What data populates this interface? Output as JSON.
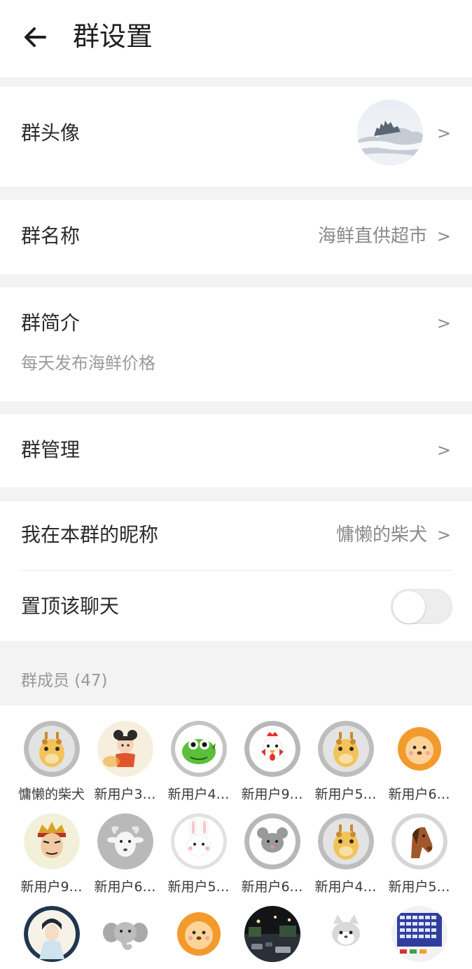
{
  "header": {
    "title": "群设置",
    "back_icon": "arrow-left-icon"
  },
  "rows": {
    "avatar": {
      "label": "群头像",
      "chevron": ">"
    },
    "name": {
      "label": "群名称",
      "value": "海鲜直供超市",
      "chevron": ">"
    },
    "intro": {
      "label": "群简介",
      "value": "每天发布海鲜价格",
      "chevron": ">"
    },
    "manage": {
      "label": "群管理",
      "chevron": ">"
    },
    "nickname": {
      "label": "我在本群的昵称",
      "value": "慵懒的柴犬",
      "chevron": ">"
    },
    "pin": {
      "label": "置顶该聊天",
      "toggle_on": false
    }
  },
  "members": {
    "title": "群成员 (47)",
    "items": [
      {
        "name": "慵懒的柴犬",
        "avatar": "giraffe-icon"
      },
      {
        "name": "新用户3…",
        "avatar": "nezha-icon"
      },
      {
        "name": "新用户4…",
        "avatar": "dragon-icon"
      },
      {
        "name": "新用户9…",
        "avatar": "rooster-icon"
      },
      {
        "name": "新用户5…",
        "avatar": "giraffe-icon"
      },
      {
        "name": "新用户6…",
        "avatar": "lion-icon"
      },
      {
        "name": "新用户9…",
        "avatar": "general-icon"
      },
      {
        "name": "新用户6…",
        "avatar": "goat-icon"
      },
      {
        "name": "新用户5…",
        "avatar": "rabbit-icon"
      },
      {
        "name": "新用户6…",
        "avatar": "mouse-icon"
      },
      {
        "name": "新用户4…",
        "avatar": "giraffe-icon"
      },
      {
        "name": "新用户5…",
        "avatar": "horse-icon"
      },
      {
        "name": "",
        "avatar": "scholar-icon"
      },
      {
        "name": "",
        "avatar": "elephant-icon"
      },
      {
        "name": "",
        "avatar": "lion-icon"
      },
      {
        "name": "",
        "avatar": "night-street-photo"
      },
      {
        "name": "",
        "avatar": "cat-icon"
      },
      {
        "name": "",
        "avatar": "keyboard-icon"
      }
    ]
  },
  "colors": {
    "page_bg": "#f3f3f3",
    "card_bg": "#ffffff",
    "muted_text": "#8a8a8a",
    "toggle_off": "#ededed"
  }
}
